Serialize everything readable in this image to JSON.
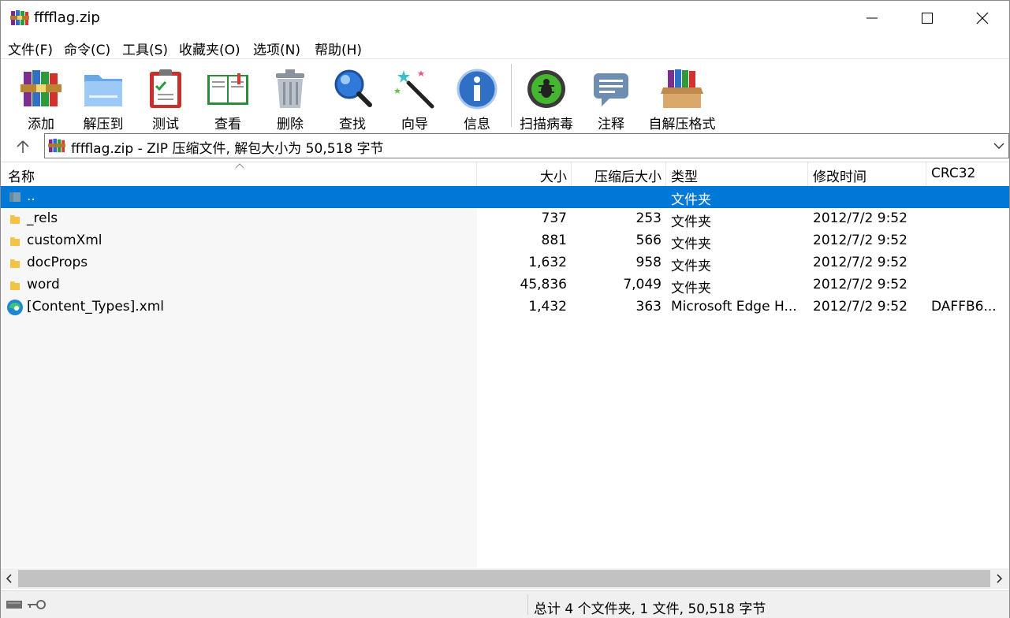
{
  "window": {
    "title": "fffflag.zip"
  },
  "menu": [
    {
      "label": "文件(F)"
    },
    {
      "label": "命令(C)"
    },
    {
      "label": "工具(S)"
    },
    {
      "label": "收藏夹(O)"
    },
    {
      "label": "选项(N)"
    },
    {
      "label": "帮助(H)"
    }
  ],
  "toolbar": [
    {
      "label": "添加",
      "icon": "add-books-icon"
    },
    {
      "label": "解压到",
      "icon": "extract-folder-icon"
    },
    {
      "label": "测试",
      "icon": "test-clipboard-icon"
    },
    {
      "label": "查看",
      "icon": "view-book-icon"
    },
    {
      "label": "删除",
      "icon": "delete-trash-icon"
    },
    {
      "label": "查找",
      "icon": "find-magnifier-icon"
    },
    {
      "label": "向导",
      "icon": "wizard-wand-icon"
    },
    {
      "label": "信息",
      "icon": "info-icon"
    },
    {
      "label": "扫描病毒",
      "icon": "virus-scan-icon"
    },
    {
      "label": "注释",
      "icon": "comment-icon"
    },
    {
      "label": "自解压格式",
      "icon": "sfx-box-icon"
    }
  ],
  "address": {
    "text": "fffflag.zip - ZIP 压缩文件, 解包大小为 50,518 字节"
  },
  "columns": {
    "name": "名称",
    "size": "大小",
    "packed": "压缩后大小",
    "type": "类型",
    "modified": "修改时间",
    "crc": "CRC32"
  },
  "files": [
    {
      "name": "..",
      "size": "",
      "packed": "",
      "type": "文件夹",
      "modified": "",
      "crc": "",
      "icon": "parent-folder-icon",
      "selected": true
    },
    {
      "name": "_rels",
      "size": "737",
      "packed": "253",
      "type": "文件夹",
      "modified": "2012/7/2 9:52",
      "crc": "",
      "icon": "folder-icon"
    },
    {
      "name": "customXml",
      "size": "881",
      "packed": "566",
      "type": "文件夹",
      "modified": "2012/7/2 9:52",
      "crc": "",
      "icon": "folder-icon"
    },
    {
      "name": "docProps",
      "size": "1,632",
      "packed": "958",
      "type": "文件夹",
      "modified": "2012/7/2 9:52",
      "crc": "",
      "icon": "folder-icon"
    },
    {
      "name": "word",
      "size": "45,836",
      "packed": "7,049",
      "type": "文件夹",
      "modified": "2012/7/2 9:52",
      "crc": "",
      "icon": "folder-icon"
    },
    {
      "name": "[Content_Types].xml",
      "size": "1,432",
      "packed": "363",
      "type": "Microsoft Edge H...",
      "modified": "2012/7/2 9:52",
      "crc": "DAFFB6...",
      "icon": "edge-icon"
    }
  ],
  "status": {
    "text": "总计 4 个文件夹, 1 文件, 50,518 字节"
  },
  "colors": {
    "selection": "#0078d7",
    "folder": "#f5c343"
  }
}
